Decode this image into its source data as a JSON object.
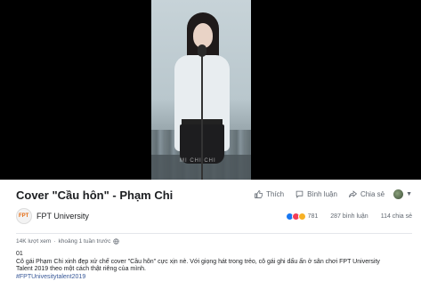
{
  "video": {
    "watermark": "MI CHI CHI"
  },
  "post": {
    "title": "Cover \"Cầu hôn\" - Phạm Chi",
    "actions": {
      "like": "Thích",
      "comment": "Bình luận",
      "share": "Chia sẻ"
    },
    "page_name": "FPT University",
    "reaction_count": "781",
    "comment_count": "287 bình luận",
    "share_count": "114 chia sẻ",
    "views": "14K lượt xem",
    "time": "khoảng 1 tuần trước",
    "desc_line1": "01",
    "desc_line2": "Cô gái Phạm Chi xinh đẹp xử chế cover \"Cầu hôn\" cực xịn nè. Với giọng hát trong trẻo, cô gái ghi dấu ấn ở sân chơi FPT University",
    "desc_line3": "Talent 2019 theo một cách thật riêng của mình.",
    "hashtag": "#FPTUnivesitytalent2019"
  },
  "colors": {
    "link": "#385898",
    "like_blue": "#1877f2",
    "love_red": "#f33e58",
    "haha_yellow": "#f7b125"
  },
  "icons": [
    "like-icon",
    "comment-icon",
    "share-icon",
    "globe-icon",
    "chevron-down-icon"
  ]
}
